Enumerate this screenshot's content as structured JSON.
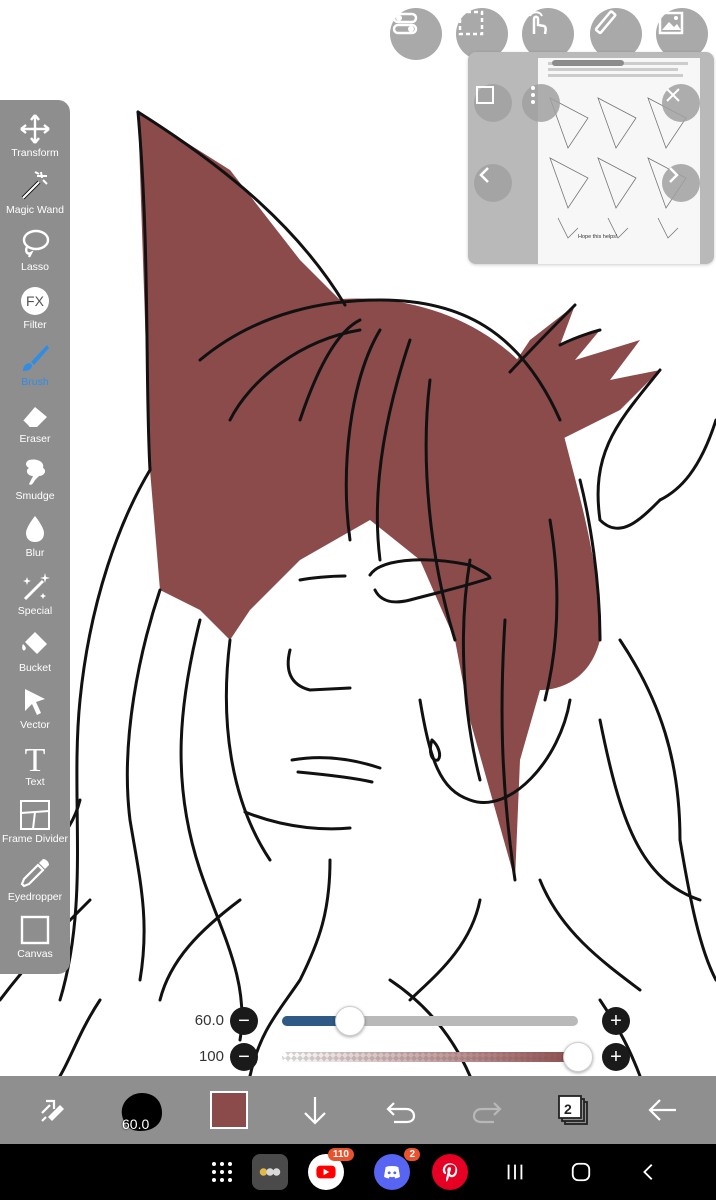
{
  "canvas": {
    "fill_color": "#8b4b4b",
    "line_color": "#111111",
    "background": "#ffffff"
  },
  "top_bar": {
    "buttons": [
      {
        "icon": "toggle-settings-icon"
      },
      {
        "icon": "selection-icon"
      },
      {
        "icon": "touch-gesture-icon"
      },
      {
        "icon": "pencil-ruler-icon"
      },
      {
        "icon": "reference-image-icon"
      }
    ]
  },
  "reference_window": {
    "caption": "Hope this helps!"
  },
  "toolbar": {
    "active": "Brush",
    "tools": [
      {
        "label": "Transform",
        "icon": "transform-icon"
      },
      {
        "label": "Magic Wand",
        "icon": "magic-wand-icon"
      },
      {
        "label": "Lasso",
        "icon": "lasso-icon"
      },
      {
        "label": "Filter",
        "icon": "fx-icon",
        "glyph": "FX"
      },
      {
        "label": "Brush",
        "icon": "brush-icon"
      },
      {
        "label": "Eraser",
        "icon": "eraser-icon"
      },
      {
        "label": "Smudge",
        "icon": "smudge-icon"
      },
      {
        "label": "Blur",
        "icon": "blur-drop-icon"
      },
      {
        "label": "Special",
        "icon": "special-brush-icon"
      },
      {
        "label": "Bucket",
        "icon": "bucket-icon"
      },
      {
        "label": "Vector",
        "icon": "vector-arrow-icon"
      },
      {
        "label": "Text",
        "icon": "text-icon",
        "glyph": "T"
      },
      {
        "label": "Frame Divider",
        "icon": "frame-divider-icon"
      },
      {
        "label": "Eyedropper",
        "icon": "eyedropper-icon"
      },
      {
        "label": "Canvas",
        "icon": "canvas-icon"
      }
    ]
  },
  "sliders": {
    "size": {
      "value_label": "60.0",
      "fraction": 0.23,
      "minus": "−",
      "plus": "+"
    },
    "opacity": {
      "value_label": "100",
      "fraction": 1.0,
      "minus": "−",
      "plus": "+",
      "color": "#8b4b4b"
    }
  },
  "bottom_bar": {
    "brush_size": "60.0",
    "current_color": "#8b4b4b",
    "layers": "2"
  },
  "nav_bar": {
    "youtube_badge": "110",
    "discord_badge": "2"
  }
}
